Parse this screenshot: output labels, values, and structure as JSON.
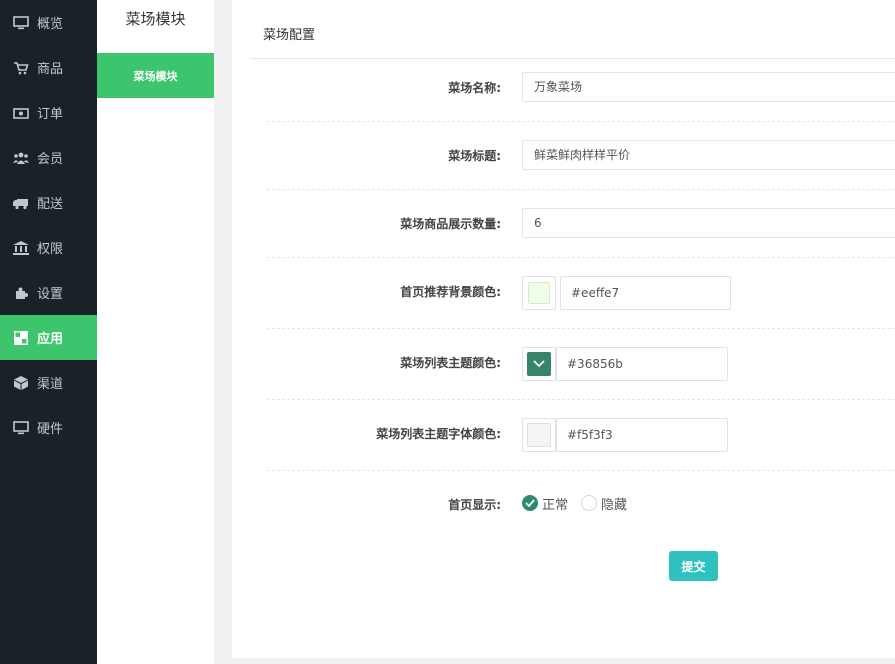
{
  "nav": {
    "items": [
      {
        "label": "概览",
        "icon": "monitor-icon"
      },
      {
        "label": "商品",
        "icon": "cart-icon"
      },
      {
        "label": "订单",
        "icon": "money-icon"
      },
      {
        "label": "会员",
        "icon": "users-icon"
      },
      {
        "label": "配送",
        "icon": "truck-icon"
      },
      {
        "label": "权限",
        "icon": "bank-icon"
      },
      {
        "label": "设置",
        "icon": "puzzle-icon"
      },
      {
        "label": "应用",
        "icon": "grid-icon",
        "active": true
      },
      {
        "label": "渠道",
        "icon": "cube-icon"
      },
      {
        "label": "硬件",
        "icon": "desktop-icon"
      }
    ]
  },
  "subnav": {
    "title": "菜场模块",
    "active_item": "菜场模块"
  },
  "panel": {
    "title": "菜场配置"
  },
  "form": {
    "name": {
      "label": "菜场名称:",
      "value": "万象菜场"
    },
    "heading": {
      "label": "菜场标题:",
      "value": "鲜菜鲜肉样样平价"
    },
    "count": {
      "label": "菜场商品展示数量:",
      "value": "6"
    },
    "home_bg": {
      "label": "首页推荐背景颜色:",
      "value": "#eeffe7"
    },
    "list_theme": {
      "label": "菜场列表主题颜色:",
      "value": "#36856b"
    },
    "list_font": {
      "label": "菜场列表主题字体颜色:",
      "value": "#f5f3f3"
    },
    "home_display": {
      "label": "首页显示:",
      "options": [
        "正常",
        "隐藏"
      ],
      "selected": "正常"
    },
    "submit_label": "提交"
  },
  "colors": {
    "sidebar_bg": "#1b2227",
    "accent_green": "#3cc56c",
    "radio_checked": "#2b8a70",
    "submit_bg": "#2fc1c0"
  }
}
